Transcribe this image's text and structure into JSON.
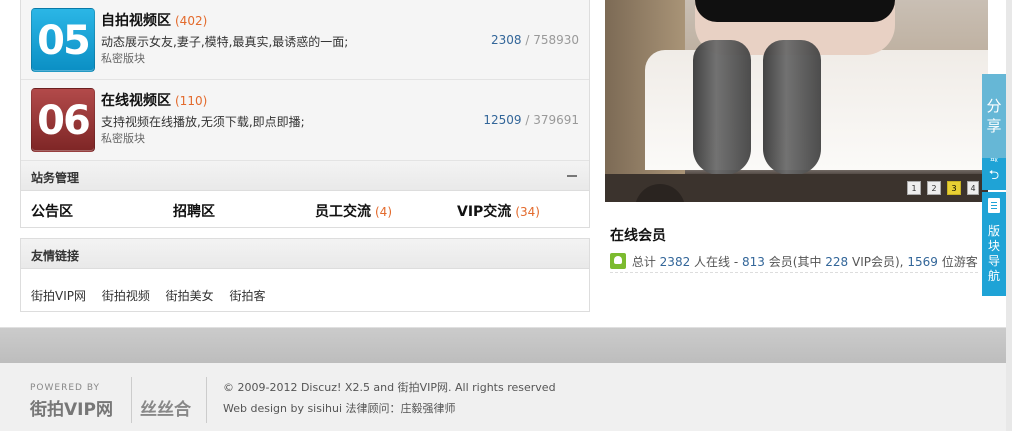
{
  "forums": [
    {
      "num": "05",
      "title": "自拍视频区",
      "count": "(402)",
      "desc": "动态展示女友,妻子,模特,最真实,最诱惑的一面;",
      "mod": "私密版块",
      "threads": "2308",
      "posts": "758930",
      "color_top": "#2bb6e6",
      "color_bottom": "#0b8fc4"
    },
    {
      "num": "06",
      "title": "在线视频区",
      "count": "(110)",
      "desc": "支持视频在线播放,无须下载,即点即播;",
      "mod": "私密版块",
      "threads": "12509",
      "posts": "379691",
      "color_top": "#b24a4a",
      "color_bottom": "#7e2626"
    }
  ],
  "management": {
    "title": "站务管理",
    "items": [
      {
        "label": "公告区",
        "count": ""
      },
      {
        "label": "招聘区",
        "count": ""
      },
      {
        "label": "员工交流",
        "count": "(4)"
      },
      {
        "label": "VIP交流",
        "count": "(34)"
      }
    ]
  },
  "links": {
    "title": "友情链接",
    "items": [
      "街拍VIP网",
      "街拍视频",
      "街拍美女",
      "街拍客"
    ]
  },
  "slideshow": {
    "pages": [
      "1",
      "2",
      "3",
      "4"
    ],
    "active": 3
  },
  "online": {
    "title": "在线会员",
    "prefix": "总计",
    "total": "2382",
    "mid1": "人在线 -",
    "members": "813",
    "mid2": "会员(其中",
    "vip": "228",
    "mid3": "VIP会员),",
    "guests": "1569",
    "suffix": "位游客"
  },
  "side_tabs": {
    "share": "分享",
    "stub": "部",
    "top": "⮌",
    "nav": "版块导航"
  },
  "footer": {
    "powered": "POWERED BY",
    "logo1": "街拍VIP网",
    "logo2": "丝丝合",
    "copyright": "© 2009-2012 Discuz! X2.5  and 街拍VIP网.  All rights reserved",
    "design": "Web design by sisihui   法律顾问：庄毅强律师"
  }
}
